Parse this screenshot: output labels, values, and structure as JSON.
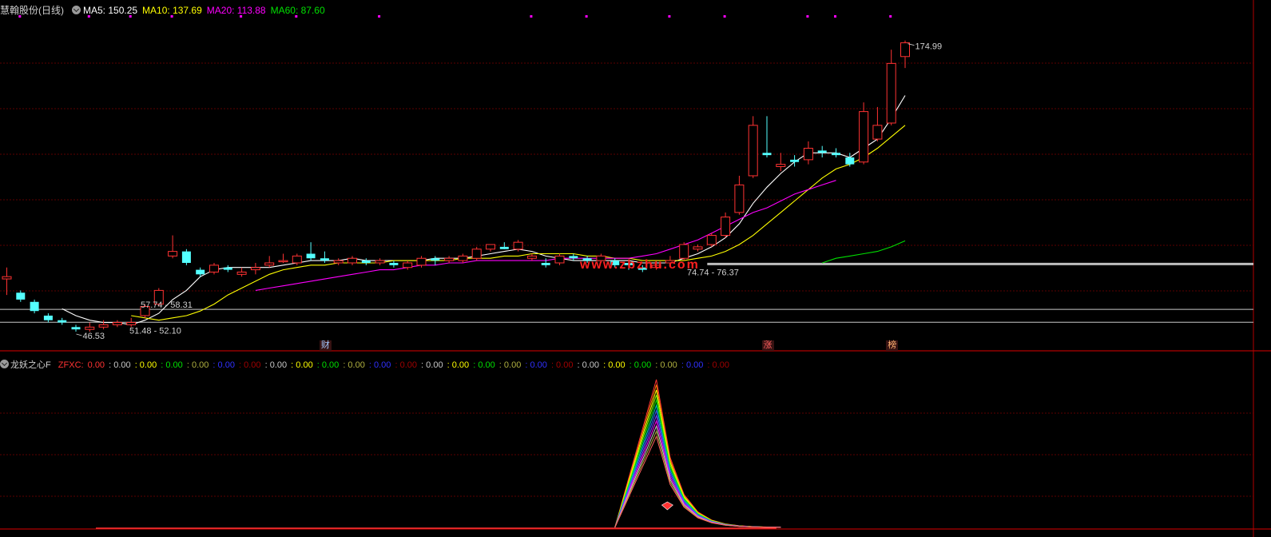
{
  "header": {
    "stock_name": "慧翰股份(日线)",
    "ma5_label": "MA5: 150.25",
    "ma10_label": "MA10: 137.69",
    "ma20_label": "MA20: 113.88",
    "ma60_label": "MA60: 87.60"
  },
  "colors": {
    "up": "#ff3232",
    "down": "#54ffff",
    "ma5": "#ffffff",
    "ma10": "#ffff00",
    "ma20": "#ff00ff",
    "ma60": "#00e000",
    "grid": "#7a0000",
    "axis": "#b00000",
    "text": "#d0d0d0"
  },
  "watermark": "www.zbzhu.com",
  "events": [
    {
      "label": "财",
      "color": "#a0c8ff",
      "index": 23
    },
    {
      "label": "涨",
      "color": "#ff6060",
      "index": 55
    },
    {
      "label": "榜",
      "color": "#ffb070",
      "index": 64
    }
  ],
  "indicator": {
    "name": "龙妖之心F",
    "prefix": "ZFXC: ",
    "readouts": [
      {
        "text": "0.00",
        "color": "#ff3232"
      },
      {
        "text": "0.00",
        "color": "#c8c8c8"
      },
      {
        "text": "0.00",
        "color": "#ffff00"
      },
      {
        "text": "0.00",
        "color": "#00e000"
      },
      {
        "text": "0.00",
        "color": "#b0b040"
      },
      {
        "text": "0.00",
        "color": "#3030ff"
      },
      {
        "text": "0.00",
        "color": "#a00000"
      },
      {
        "text": "0.00",
        "color": "#c8c8c8"
      },
      {
        "text": "0.00",
        "color": "#ffff00"
      },
      {
        "text": "0.00",
        "color": "#00e000"
      },
      {
        "text": "0.00",
        "color": "#b0b040"
      },
      {
        "text": "0.00",
        "color": "#3030ff"
      },
      {
        "text": "0.00",
        "color": "#a00000"
      },
      {
        "text": "0.00",
        "color": "#c8c8c8"
      },
      {
        "text": "0.00",
        "color": "#ffff00"
      },
      {
        "text": "0.00",
        "color": "#00e000"
      },
      {
        "text": "0.00",
        "color": "#b0b040"
      },
      {
        "text": "0.00",
        "color": "#3030ff"
      },
      {
        "text": "0.00",
        "color": "#a00000"
      },
      {
        "text": "0.00",
        "color": "#c8c8c8"
      },
      {
        "text": "0.00",
        "color": "#ffff00"
      },
      {
        "text": "0.00",
        "color": "#00e000"
      },
      {
        "text": "0.00",
        "color": "#b0b040"
      },
      {
        "text": "0.00",
        "color": "#3030ff"
      },
      {
        "text": "0.00",
        "color": "#a00000"
      }
    ],
    "curve_colors": [
      "#ff3232",
      "#ff8000",
      "#ffff00",
      "#80ff00",
      "#00e000",
      "#00c0c0",
      "#3060ff",
      "#8040ff",
      "#ff00ff",
      "#c8c8c8",
      "#b0b040",
      "#ff6060"
    ],
    "peak_index": 47,
    "peak_value": 1.0
  },
  "chart_data": {
    "type": "candlestick",
    "ylim": [
      40,
      185
    ],
    "max_label": "174.99",
    "min_label": "46.53",
    "range_labels": [
      "57.74 - 58.31",
      "51.48 - 52.10",
      "74.74 - 76.37"
    ],
    "range_levels": [
      {
        "label_index": 0,
        "value": 57.74,
        "color": "#c8c8c8"
      },
      {
        "label_index": 1,
        "value": 52.1,
        "color": "#c8c8c8"
      },
      {
        "label_index": 2,
        "value": 77.5,
        "color": "#bdbdbd",
        "thick": true
      }
    ],
    "candles": [
      [
        71,
        72,
        76,
        64
      ],
      [
        65,
        62,
        66,
        61
      ],
      [
        61,
        57,
        62,
        56
      ],
      [
        55,
        53,
        56,
        52
      ],
      [
        53,
        52,
        54,
        51
      ],
      [
        50,
        49,
        51,
        48
      ],
      [
        49,
        50,
        52,
        48
      ],
      [
        50,
        51,
        53,
        49
      ],
      [
        51,
        52,
        53,
        50
      ],
      [
        51,
        52,
        54,
        50
      ],
      [
        55,
        59,
        60,
        54
      ],
      [
        60,
        66,
        67,
        59
      ],
      [
        81,
        83,
        90,
        80
      ],
      [
        83,
        78,
        84,
        77
      ],
      [
        75,
        73,
        76,
        72
      ],
      [
        74,
        77,
        78,
        73
      ],
      [
        76,
        75,
        77,
        74
      ],
      [
        73,
        74,
        76,
        72
      ],
      [
        75,
        76,
        78,
        73
      ],
      [
        77,
        78,
        81,
        76
      ],
      [
        79,
        79,
        82,
        78
      ],
      [
        78,
        81,
        82,
        77
      ],
      [
        82,
        80,
        87,
        79
      ],
      [
        80,
        79,
        83,
        78
      ],
      [
        78,
        79,
        80,
        77
      ],
      [
        78,
        80,
        81,
        77
      ],
      [
        79,
        78,
        80,
        77
      ],
      [
        78,
        79,
        80,
        77
      ],
      [
        78,
        77,
        79,
        76
      ],
      [
        76,
        78,
        79,
        75
      ],
      [
        77,
        80,
        81,
        76
      ],
      [
        80,
        79,
        81,
        77
      ],
      [
        79,
        80,
        81,
        78
      ],
      [
        79,
        81,
        82,
        78
      ],
      [
        80,
        84,
        85,
        79
      ],
      [
        84,
        86,
        86,
        83
      ],
      [
        85,
        84,
        87,
        84
      ],
      [
        84,
        87,
        88,
        83
      ],
      [
        80,
        81,
        82,
        79
      ],
      [
        78,
        77,
        80,
        76
      ],
      [
        78,
        81,
        82,
        77
      ],
      [
        81,
        80,
        82,
        79
      ],
      [
        80,
        79,
        81,
        78
      ],
      [
        79,
        81,
        82,
        78
      ],
      [
        79,
        77,
        80,
        76
      ],
      [
        78,
        77,
        79,
        75
      ],
      [
        76,
        75,
        77,
        74
      ],
      [
        76,
        77,
        79,
        75
      ],
      [
        78,
        79,
        81,
        77
      ],
      [
        80,
        86,
        87,
        79
      ],
      [
        84,
        85,
        86,
        83
      ],
      [
        86,
        90,
        91,
        85
      ],
      [
        90,
        98,
        100,
        89
      ],
      [
        100,
        112,
        116,
        99
      ],
      [
        116,
        138,
        142,
        115
      ],
      [
        126,
        125,
        142,
        124
      ],
      [
        120,
        121,
        126,
        118
      ],
      [
        123,
        122,
        125,
        120
      ],
      [
        123,
        128,
        131,
        121
      ],
      [
        127,
        126,
        129,
        124
      ],
      [
        126,
        125,
        128,
        124
      ],
      [
        124,
        121,
        126,
        120
      ],
      [
        122,
        144,
        148,
        121
      ],
      [
        132,
        138,
        146,
        131
      ],
      [
        139,
        165,
        171,
        138
      ],
      [
        168,
        174,
        175,
        163
      ]
    ],
    "ma5": [
      null,
      null,
      null,
      null,
      58,
      55,
      53,
      52,
      52,
      51,
      53,
      56,
      62,
      66,
      72,
      75,
      76,
      76,
      76,
      76,
      77,
      78,
      79,
      79,
      79,
      80,
      79,
      79,
      79,
      79,
      79,
      80,
      80,
      80,
      81,
      82,
      83,
      84,
      83,
      81,
      80,
      79,
      79,
      79,
      79,
      79,
      78,
      78,
      78,
      80,
      82,
      85,
      89,
      95,
      104,
      111,
      117,
      122,
      126,
      126,
      126,
      124,
      128,
      132,
      141,
      151
    ],
    "ma10": [
      null,
      null,
      null,
      null,
      null,
      null,
      null,
      null,
      null,
      55,
      54,
      53,
      54,
      55,
      57,
      60,
      64,
      67,
      70,
      73,
      75,
      76,
      77,
      77,
      78,
      78,
      78,
      78,
      79,
      79,
      79,
      79,
      79,
      80,
      80,
      80,
      81,
      81,
      82,
      82,
      82,
      82,
      81,
      81,
      80,
      80,
      79,
      79,
      79,
      79,
      80,
      81,
      83,
      86,
      90,
      95,
      100,
      105,
      110,
      115,
      119,
      121,
      124,
      128,
      133,
      138
    ],
    "ma20_start": 18,
    "ma20": [
      66,
      67,
      68,
      69,
      70,
      71,
      72,
      73,
      74,
      75,
      75,
      76,
      77,
      77,
      78,
      78,
      79,
      79,
      79,
      79,
      79,
      79,
      80,
      80,
      80,
      80,
      80,
      80,
      81,
      82,
      84,
      86,
      88,
      91,
      94,
      97,
      100,
      102,
      105,
      108,
      110,
      112,
      114
    ],
    "ma60_start": 59,
    "ma60": [
      78,
      80,
      81,
      82,
      83,
      85,
      87.6
    ]
  }
}
